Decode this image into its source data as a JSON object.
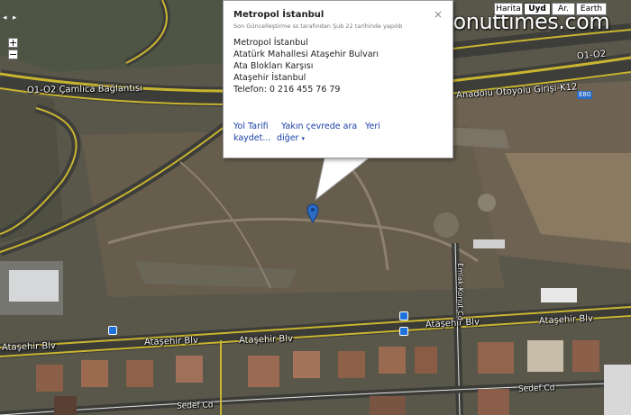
{
  "map": {
    "road_labels": [
      "O1-O2 Çamlıca Bağlantısı",
      "Anadolu Otoyolu Girişi-K12",
      "O1-O2",
      "Ataşehir Blv",
      "Ataşehir Blv",
      "Ataşehir Blv",
      "Ataşehir Blv",
      "Emlak-Konut Cd",
      "Sedef Cd",
      "Sedef Cd",
      "Ataşehir Blv"
    ],
    "highway_shield": "E80",
    "pan_arrow_left": "◂",
    "pan_arrow_right": "▸"
  },
  "zoom": {
    "in_label": "+",
    "out_label": "−"
  },
  "map_types": [
    {
      "label": "Harita",
      "active": false
    },
    {
      "label": "Uyd",
      "active": true
    },
    {
      "label": "Ar.",
      "active": false
    },
    {
      "label": "Earth",
      "active": false
    }
  ],
  "watermark": "konuttimes.com",
  "info_window": {
    "title": "Metropol İstanbul",
    "subtitle": "Son Güncelleştirme ss tarafından Şub 22 tarihinde yapıldı",
    "close_icon": "×",
    "address_lines": [
      "Metropol İstanbul",
      "Atatürk Mahallesi Ataşehir Bulvarı",
      "Ata Blokları Karşısı",
      "Ataşehir İstanbul",
      "Telefon: 0 216 455 76 79"
    ],
    "links": {
      "directions": "Yol Tarifi",
      "search_nearby": "Yakın çevrede ara",
      "save_line1": "Yeri",
      "save_line2": "kaydet...",
      "more": "diğer",
      "more_arrow": "▾"
    }
  },
  "marker": {
    "icon": "map-pin-icon",
    "color": "#2a6bc4"
  }
}
